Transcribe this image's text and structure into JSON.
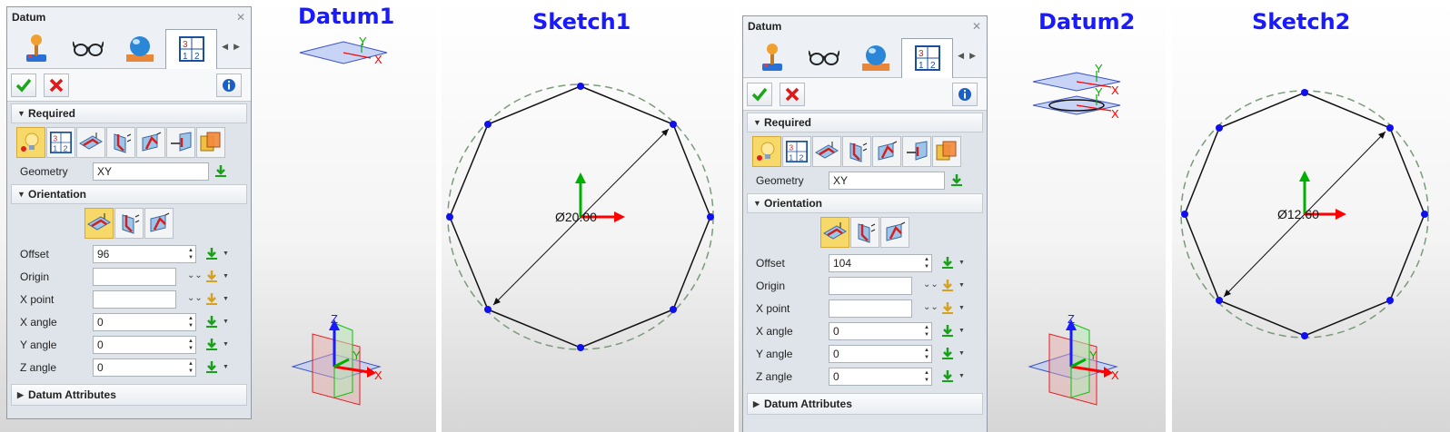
{
  "left_panel": {
    "title": "Datum",
    "sections": {
      "required": "Required",
      "orientation": "Orientation",
      "attributes": "Datum Attributes"
    },
    "fields": {
      "geometry_label": "Geometry",
      "geometry_value": "XY",
      "offset_label": "Offset",
      "offset_value": "96",
      "origin_label": "Origin",
      "origin_value": "",
      "xpoint_label": "X point",
      "xpoint_value": "",
      "xangle_label": "X angle",
      "xangle_value": "0",
      "yangle_label": "Y angle",
      "yangle_value": "0",
      "zangle_label": "Z angle",
      "zangle_value": "0"
    }
  },
  "right_panel": {
    "title": "Datum",
    "sections": {
      "required": "Required",
      "orientation": "Orientation",
      "attributes": "Datum Attributes"
    },
    "fields": {
      "geometry_label": "Geometry",
      "geometry_value": "XY",
      "offset_label": "Offset",
      "offset_value": "104",
      "origin_label": "Origin",
      "origin_value": "",
      "xpoint_label": "X point",
      "xpoint_value": "",
      "xangle_label": "X angle",
      "xangle_value": "0",
      "yangle_label": "Y angle",
      "yangle_value": "0",
      "zangle_label": "Z angle",
      "zangle_value": "0"
    }
  },
  "views": {
    "datum1": {
      "label": "Datum1",
      "axis_x": "X",
      "axis_y": "Y",
      "axis_z": "Z"
    },
    "sketch1": {
      "label": "Sketch1",
      "dimension": "Ø20.00"
    },
    "datum2": {
      "label": "Datum2",
      "axis_x": "X",
      "axis_y": "Y",
      "axis_z": "Z"
    },
    "sketch2": {
      "label": "Sketch2",
      "dimension": "Ø12.60"
    }
  },
  "colors": {
    "view_label": "#1a1aff",
    "vertex": "#1010ee",
    "axis_x": "#ff0000",
    "axis_y": "#00b000",
    "axis_z": "#1a1aff"
  },
  "icons": {
    "tabs": [
      "joystick-icon",
      "glasses-icon",
      "sphere-icon",
      "sketch-grid-icon"
    ],
    "required_row": [
      "lightbulb-icon",
      "sketch-grid-icon",
      "plane-offset-icon",
      "plane-three-point-icon",
      "plane-angle-icon",
      "plane-normal-icon",
      "plane-parallel-icon"
    ],
    "orientation_row": [
      "plane-offset-icon",
      "plane-three-point-icon",
      "plane-angle-icon"
    ]
  }
}
